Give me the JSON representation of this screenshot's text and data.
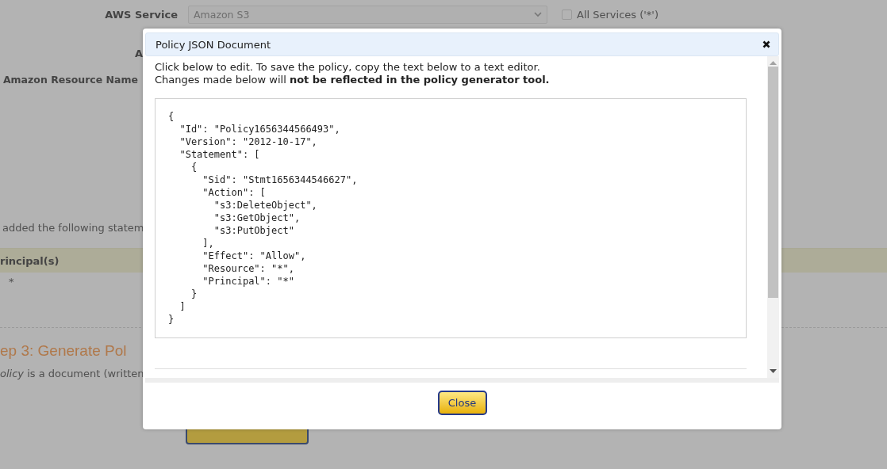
{
  "page": {
    "service_label": "AWS Service",
    "service_select": {
      "value": "Amazon S3"
    },
    "all_services": {
      "label": "All Services ('*')",
      "checked": false
    },
    "label_2": "A",
    "arn_label": "Amazon Resource Name",
    "statement_note": "added the following statem",
    "table": {
      "columns": [
        "rincipal(s)"
      ],
      "rows": [
        [
          "*"
        ]
      ]
    },
    "step_heading": "ep 3: Generate Pol",
    "step_text": "*olicy* is a document (written"
  },
  "dialog": {
    "title": "Policy JSON Document",
    "intro": [
      "Click below to edit. To save the policy, copy the text below to a text editor.",
      "Changes made below will **not be reflected in the policy generator tool.**"
    ],
    "document": "{\n  \"Id\": \"Policy1656344566493\",\n  \"Version\": \"2012-10-17\",\n  \"Statement\": [\n    {\n      \"Sid\": \"Stmt1656344546627\",\n      \"Action\": [\n        \"s3:DeleteObject\",\n        \"s3:GetObject\",\n        \"s3:PutObject\"\n      ],\n      \"Effect\": \"Allow\",\n      \"Resource\": \"*\",\n      \"Principal\": \"*\"\n    }\n  ]\n}",
    "buttons": [
      "Close"
    ]
  }
}
